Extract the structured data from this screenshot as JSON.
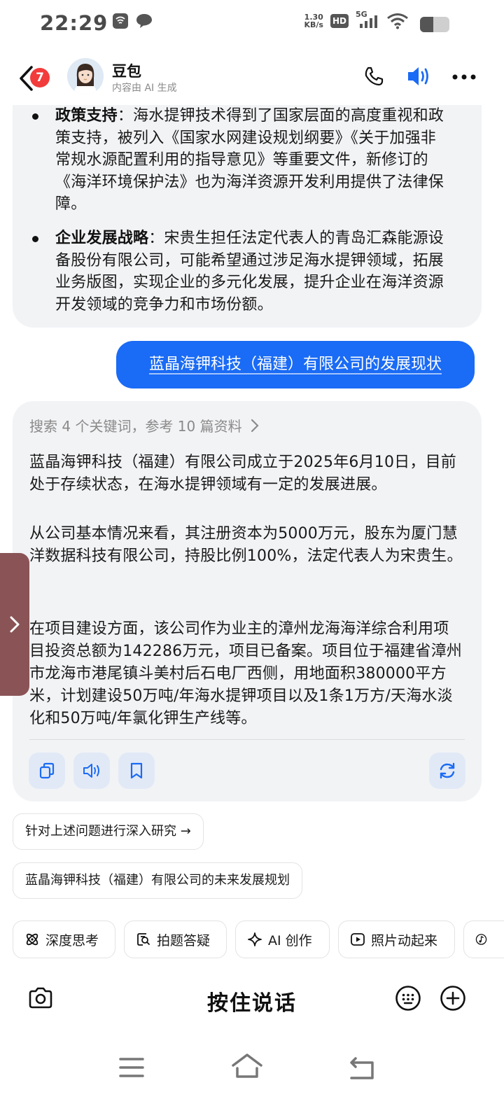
{
  "status_bar": {
    "time": "22:29",
    "net_speed_value": "1.30",
    "net_speed_unit": "KB/s",
    "hd": "HD",
    "network": "5G",
    "battery_level_percent": 45
  },
  "header": {
    "unread_count": "7",
    "bot_name": "豆包",
    "subtitle": "内容由 AI 生成",
    "icons": [
      "back-icon",
      "phone-icon",
      "speaker-icon",
      "more-icon"
    ]
  },
  "prev_answer": {
    "bullets": [
      {
        "title": "政策支持",
        "text": "：海水提钾技术得到了国家层面的高度重视和政策支持，被列入《国家水网建设规划纲要》《关于加强非常规水源配置利用的指导意见》等重要文件，新修订的《海洋环境保护法》也为海洋资源开发利用提供了法律保障。"
      },
      {
        "title": "企业发展战略",
        "text": "：宋贵生担任法定代表人的青岛汇森能源设备股份有限公司，可能希望通过涉足海水提钾领域，拓展业务版图，实现企业的多元化发展，提升企业在海洋资源开发领域的竞争力和市场份额。"
      }
    ]
  },
  "user_message": "蓝晶海钾科技（福建）有限公司的发展现状",
  "answer": {
    "search_summary": "搜索 4 个关键词，参考 10 篇资料",
    "paragraphs": [
      "蓝晶海钾科技（福建）有限公司成立于2025年6月10日，目前处于存续状态，在海水提钾领域有一定的发展进展。",
      "从公司基本情况来看，其注册资本为5000万元，股东为厦门慧洋数据科技有限公司，持股比例100%，法定代表人为宋贵生。",
      "在项目建设方面，该公司作为业主的漳州龙海海洋综合利用项目投资总额为142286万元，项目已备案。项目位于福建省漳州市龙海市港尾镇斗美村后石电厂西侧，用地面积380000平方米，计划建设50万吨/年海水提钾项目以及1条1万方/天海水淡化和50万吨/年氯化钾生产线等。"
    ],
    "actions": [
      "copy-icon",
      "read-aloud-icon",
      "bookmark-icon",
      "regenerate-icon"
    ]
  },
  "suggestions": [
    "针对上述问题进行深入研究 →",
    "蓝晶海钾科技（福建）有限公司的未来发展规划"
  ],
  "tools": [
    {
      "label": "深度思考",
      "icon": "deep-think-icon"
    },
    {
      "label": "拍题答疑",
      "icon": "photo-question-icon"
    },
    {
      "label": "AI 创作",
      "icon": "sparkle-icon"
    },
    {
      "label": "照片动起来",
      "icon": "play-icon"
    },
    {
      "label": "",
      "icon": "music-icon"
    }
  ],
  "input_bar": {
    "hold_to_talk": "按住说话",
    "icons": [
      "camera-icon",
      "keyboard-icon",
      "plus-icon"
    ]
  },
  "colors": {
    "accent": "#1a6bf5",
    "bubble_bg": "#f2f3f5",
    "badge_red": "#f23b3b",
    "action_bg": "#e2e9f6"
  }
}
